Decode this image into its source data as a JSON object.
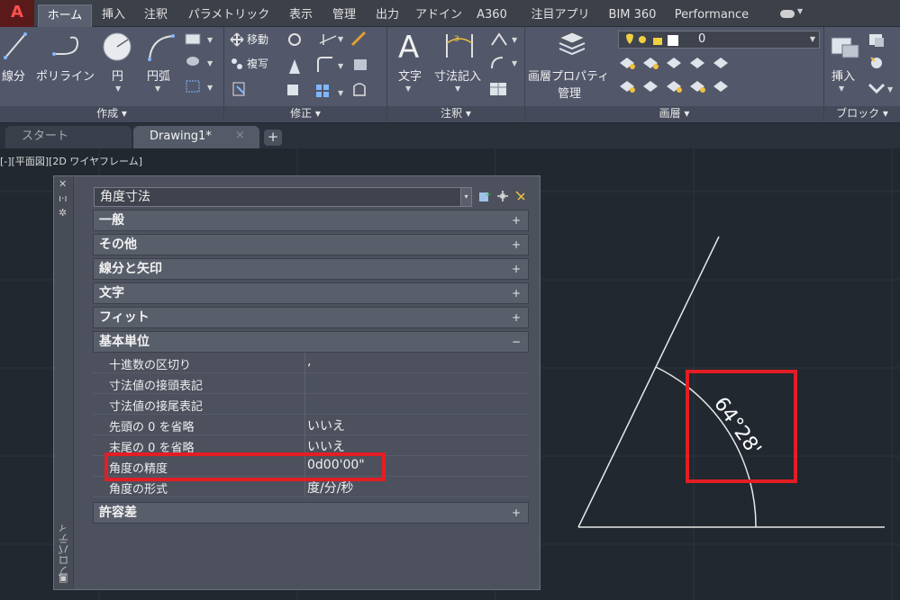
{
  "ribbon_tabs": [
    "ホーム",
    "挿入",
    "注釈",
    "パラメトリック",
    "表示",
    "管理",
    "出力",
    "アドイン",
    "A360",
    "注目アプリ",
    "BIM 360",
    "Performance"
  ],
  "panels": {
    "draw": {
      "title": "作成 ▾",
      "line": "線分",
      "polyline": "ポリライン",
      "circle": "円",
      "arc": "円弧"
    },
    "modify": {
      "title": "修正 ▾",
      "move": "移動",
      "copy": "複写"
    },
    "annotation": {
      "title": "注釈 ▾",
      "text": "文字",
      "dimension": "寸法記入"
    },
    "layers": {
      "title": "画層 ▾",
      "layer_props_1": "画層プロパティ",
      "layer_props_2": "管理",
      "current_layer": "0"
    },
    "block": {
      "title": "ブロック ▾",
      "insert": "挿入"
    }
  },
  "file_tabs": {
    "start": "スタート",
    "drawing": "Drawing1*",
    "close": "×",
    "add": "+"
  },
  "viewport": {
    "label": "[-][平面図][2D ワイヤフレーム]"
  },
  "palette": {
    "vertical_title": "プロパティ",
    "object_type": "角度寸法",
    "categories": [
      {
        "label": "一般",
        "toggle": "+"
      },
      {
        "label": "その他",
        "toggle": "+"
      },
      {
        "label": "線分と矢印",
        "toggle": "+"
      },
      {
        "label": "文字",
        "toggle": "+"
      },
      {
        "label": "フィット",
        "toggle": "+"
      },
      {
        "label": "基本単位",
        "toggle": "−"
      }
    ],
    "properties": [
      {
        "name": "十進数の区切り",
        "value": ","
      },
      {
        "name": "寸法値の接頭表記",
        "value": ""
      },
      {
        "name": "寸法値の接尾表記",
        "value": ""
      },
      {
        "name": "先頭の 0 を省略",
        "value": "いいえ"
      },
      {
        "name": "末尾の 0 を省略",
        "value": "いいえ"
      },
      {
        "name": "角度の精度",
        "value": "0d00'00\""
      },
      {
        "name": "角度の形式",
        "value": "度/分/秒"
      }
    ],
    "tolerance": {
      "label": "許容差",
      "toggle": "+"
    }
  },
  "drawing": {
    "angle_text": "64°28'"
  },
  "colors": {
    "highlight": "#e31e24",
    "ribbon_bg": "#52576a",
    "canvas_bg": "#212830"
  }
}
